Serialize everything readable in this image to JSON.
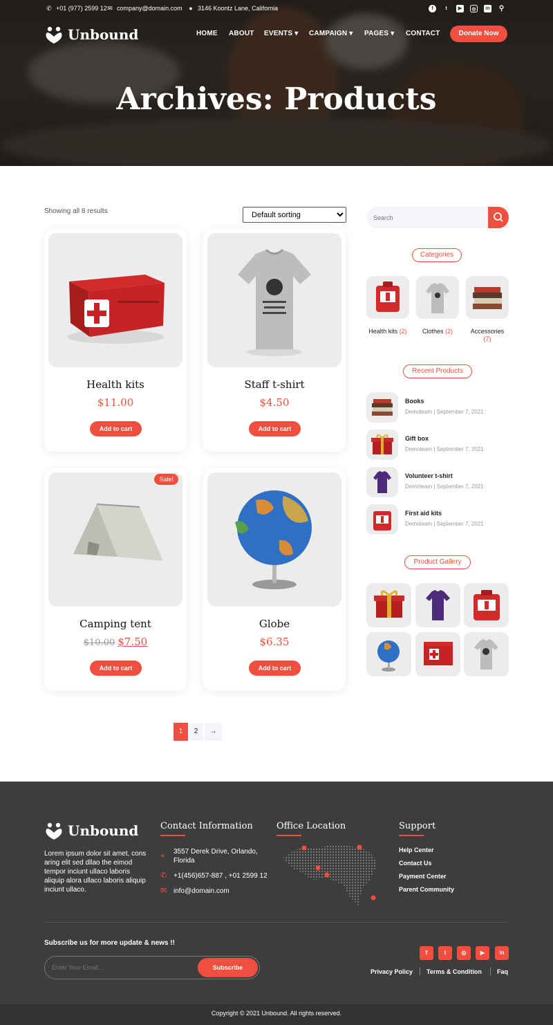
{
  "topbar": {
    "phone": "+01 (977) 2599 12",
    "email": "company@domain.com",
    "address": "3146 Koontz Lane, California"
  },
  "brand": {
    "name": "Unbound",
    "accent": "#f04e3e"
  },
  "nav": {
    "home": "HOME",
    "about": "ABOUT",
    "events": "EVENTS",
    "campaign": "CAMPAIGN",
    "pages": "PAGES",
    "contact": "CONTACT",
    "donate": "Donate Now"
  },
  "hero": {
    "title": "Archives: Products"
  },
  "shop": {
    "result_count": "Showing all 8 results",
    "sorting": "Default sorting",
    "products": [
      {
        "name": "Health kits",
        "price": "$11.00",
        "button": "Add to cart"
      },
      {
        "name": "Staff t-shirt",
        "price": "$4.50",
        "button": "Add to cart"
      },
      {
        "name": "Camping tent",
        "old_price": "$10.00",
        "price": "$7.50",
        "badge": "Sale!",
        "button": "Add to cart"
      },
      {
        "name": "Globe",
        "price": "$6.35",
        "button": "Add to cart"
      }
    ],
    "pagination": {
      "p1": "1",
      "p2": "2",
      "next": "→"
    }
  },
  "sidebar": {
    "search_placeholder": "Search",
    "categories_title": "Categories",
    "categories": [
      {
        "label": "Health kits",
        "count": "(2)"
      },
      {
        "label": "Clothes",
        "count": "(2)"
      },
      {
        "label": "Accessories",
        "count": "(7)"
      }
    ],
    "recent_title": "Recent Products",
    "recent": [
      {
        "title": "Books",
        "meta": "Demoteam | September 7, 2021"
      },
      {
        "title": "Gift box",
        "meta": "Demoteam | September 7, 2021"
      },
      {
        "title": "Volunteer t-shirt",
        "meta": "Demoteam | September 7, 2021"
      },
      {
        "title": "First aid kits",
        "meta": "Demoteam | September 7, 2021"
      }
    ],
    "gallery_title": "Product Gallery"
  },
  "footer": {
    "about": "Lorem ipsum dolor sit amet, cons aring elit sed dllao the eimod tempor inciunt ullaco laboris aliquip alora ullaco laboris aliquip inciunt ullaco.",
    "contact_title": "Contact Information",
    "contact_address_l1": "3557 Derek Drive, Orlando,",
    "contact_address_l2": "Florida",
    "contact_phone": "+1(456)657-887 , +01 2599 12",
    "contact_email": "info@domain.com",
    "office_title": "Office Location",
    "support_title": "Support",
    "support_links": [
      "Help Center",
      "Contact Us",
      "Payment Center",
      "Parent Community"
    ],
    "subscribe_title": "Subscribe us for more update & news !!",
    "email_placeholder": "Enter Your Email...",
    "subscribe_button": "Subscribe",
    "legal": [
      "Privacy Policy",
      "Terms & Condition",
      "Faq"
    ],
    "copyright": "Copyright © 2021 Unbound. All rights reserved."
  }
}
